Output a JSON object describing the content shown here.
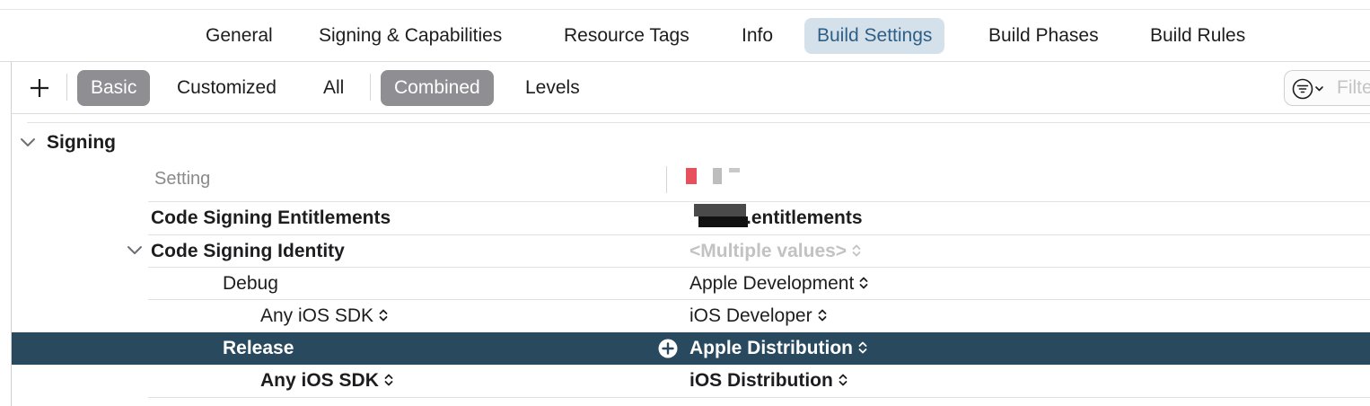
{
  "tabs": [
    {
      "label": "General",
      "selected": false
    },
    {
      "label": "Signing & Capabilities",
      "selected": false
    },
    {
      "label": "Resource Tags",
      "selected": false
    },
    {
      "label": "Info",
      "selected": false
    },
    {
      "label": "Build Settings",
      "selected": true
    },
    {
      "label": "Build Phases",
      "selected": false
    },
    {
      "label": "Build Rules",
      "selected": false
    }
  ],
  "toolbar": {
    "add_icon": "plus-icon",
    "scope": [
      {
        "label": "Basic",
        "selected": true
      },
      {
        "label": "Customized",
        "selected": false
      },
      {
        "label": "All",
        "selected": false
      }
    ],
    "view": [
      {
        "label": "Combined",
        "selected": true
      },
      {
        "label": "Levels",
        "selected": false
      }
    ],
    "filter": {
      "placeholder": "Filter",
      "icon": "filter-options-icon"
    }
  },
  "section": {
    "title": "Signing",
    "expanded": true,
    "column_header": "Setting",
    "rows": [
      {
        "setting": "Code Signing Entitlements",
        "value": ".entitlements"
      },
      {
        "setting": "Code Signing Identity",
        "value": "<Multiple values>",
        "expanded": true
      },
      {
        "setting": "Debug",
        "value": "Apple Development"
      },
      {
        "setting": "Any iOS SDK",
        "value": "iOS Developer"
      },
      {
        "setting": "Release",
        "value": "Apple Distribution",
        "selected": true
      },
      {
        "setting": "Any iOS SDK",
        "value": "iOS Distribution"
      }
    ]
  },
  "colors": {
    "selected_tab_bg": "#d5e1ea",
    "selected_tab_text": "#2e5f86",
    "selected_segment_bg": "#8e8e93",
    "selected_row_bg": "#28495e"
  }
}
